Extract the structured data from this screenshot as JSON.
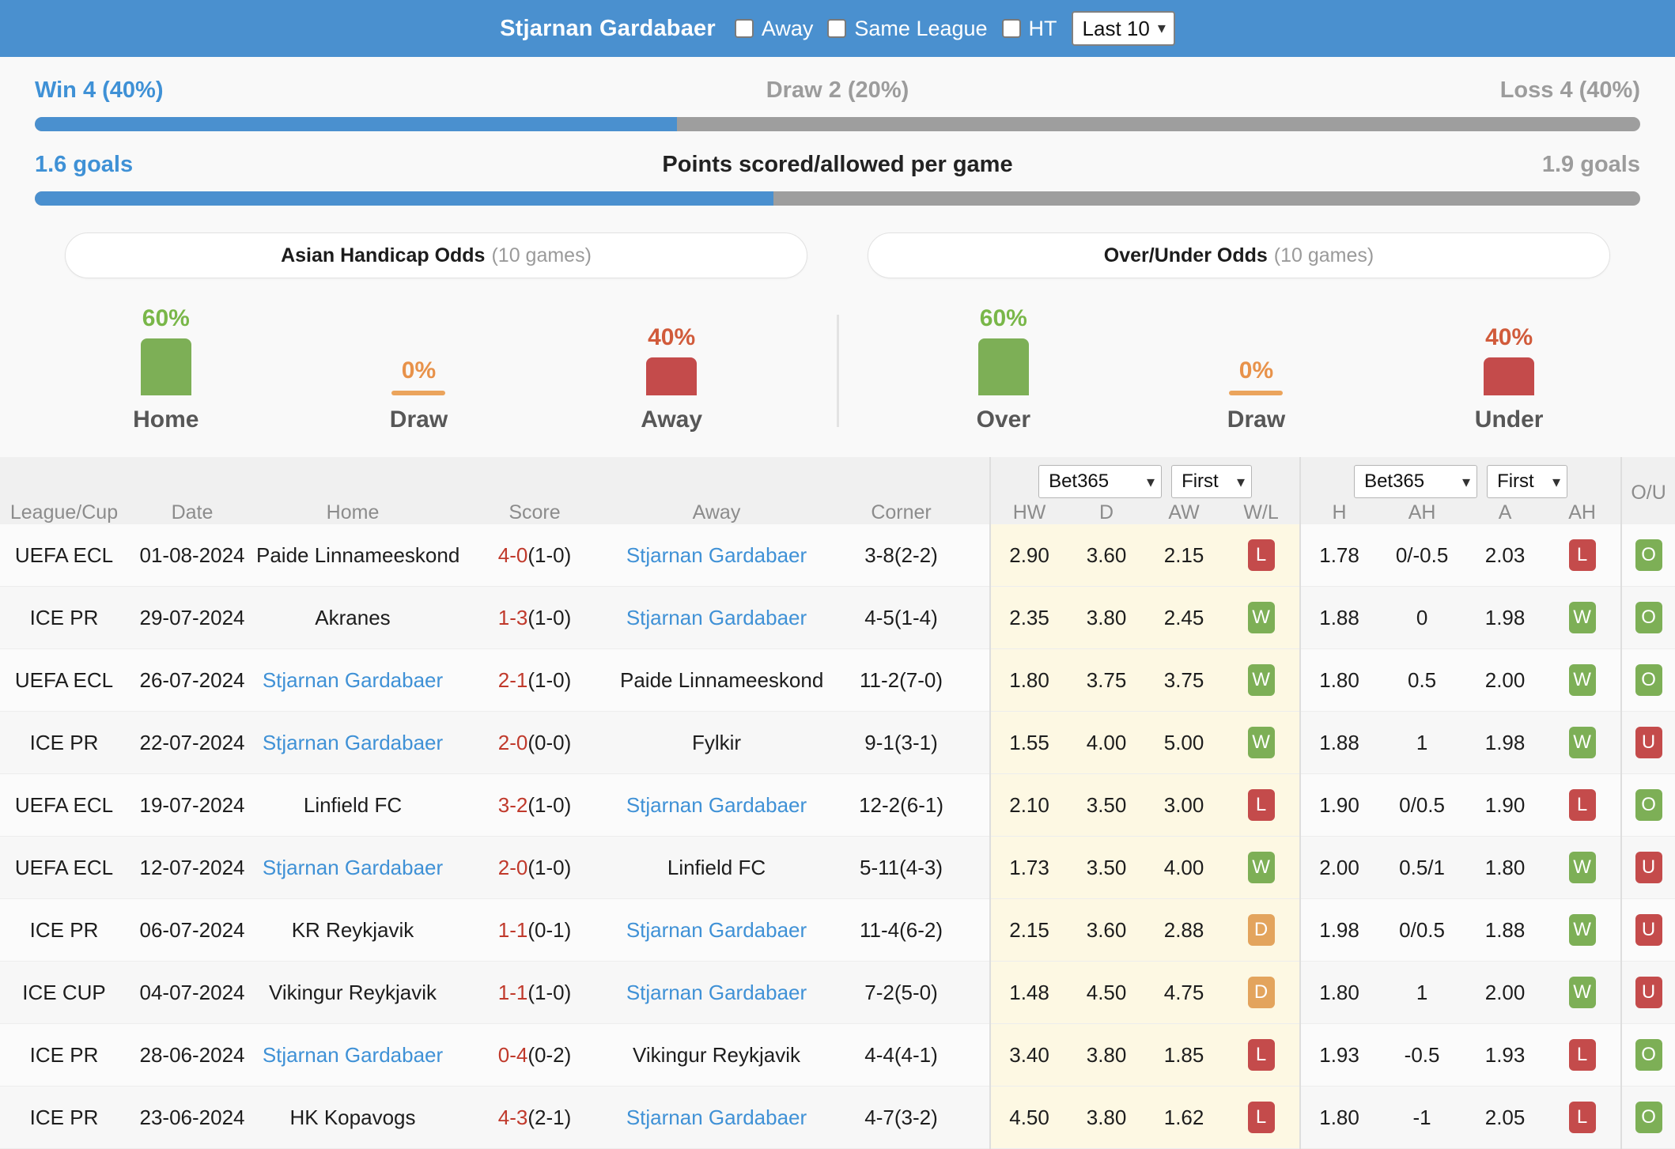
{
  "header": {
    "team": "Stjarnan Gardabaer",
    "filters": [
      {
        "label": "Away",
        "checked": false
      },
      {
        "label": "Same League",
        "checked": false
      },
      {
        "label": "HT",
        "checked": false
      }
    ],
    "range_select": {
      "value": "Last 10",
      "caret": "chevron-down-icon"
    }
  },
  "summary": {
    "wdl": {
      "left": "Win 4 (40%)",
      "center": "Draw 2 (20%)",
      "right": "Loss 4 (40%)",
      "fill_pct": 40
    },
    "goals": {
      "left": "1.6 goals",
      "center": "Points scored/allowed per game",
      "right": "1.9 goals",
      "fill_pct": 46
    }
  },
  "tabs": [
    {
      "label": "Asian Handicap Odds",
      "sub": "(10 games)",
      "active": true
    },
    {
      "label": "Over/Under Odds",
      "sub": "(10 games)",
      "active": false
    }
  ],
  "chart_data": [
    {
      "type": "bar",
      "title": "Asian Handicap Odds (10 games)",
      "categories": [
        "Home",
        "Draw",
        "Away"
      ],
      "values": [
        60,
        0,
        40
      ],
      "labels": [
        "60%",
        "0%",
        "40%"
      ],
      "colors": [
        "#7daf56",
        "#eba45c",
        "#c44b4b"
      ],
      "ylabel": "",
      "xlabel": "",
      "ylim": [
        0,
        100
      ],
      "grid": false,
      "legend": "none"
    },
    {
      "type": "bar",
      "title": "Over/Under Odds (10 games)",
      "categories": [
        "Over",
        "Draw",
        "Under"
      ],
      "values": [
        60,
        0,
        40
      ],
      "labels": [
        "60%",
        "0%",
        "40%"
      ],
      "colors": [
        "#7daf56",
        "#eba45c",
        "#c44b4b"
      ],
      "ylabel": "",
      "xlabel": "",
      "ylim": [
        0,
        100
      ],
      "grid": false,
      "legend": "none"
    }
  ],
  "table": {
    "headers": {
      "league": "League/Cup",
      "date": "Date",
      "home": "Home",
      "score": "Score",
      "away": "Away",
      "corner": "Corner",
      "hw": "HW",
      "d": "D",
      "aw": "AW",
      "wl": "W/L",
      "h": "H",
      "ah1": "AH",
      "a": "A",
      "ah2": "AH",
      "ou": "O/U"
    },
    "selectors": {
      "book1": "Bet365",
      "time1": "First",
      "book2": "Bet365",
      "time2": "First"
    },
    "rows": [
      {
        "league": "UEFA ECL",
        "date": "01-08-2024",
        "home": "Paide Linnameeskond",
        "home_hl": false,
        "score": "4-0",
        "score_sub": "(1-0)",
        "away": "Stjarnan Gardabaer",
        "away_hl": true,
        "corner": "3-8(2-2)",
        "hw": "2.90",
        "d": "3.60",
        "aw": "2.15",
        "wl": "L",
        "h": "1.78",
        "ah1": "0/-0.5",
        "a": "2.03",
        "ah2": "L",
        "ou": "O"
      },
      {
        "league": "ICE PR",
        "date": "29-07-2024",
        "home": "Akranes",
        "home_hl": false,
        "score": "1-3",
        "score_sub": "(1-0)",
        "away": "Stjarnan Gardabaer",
        "away_hl": true,
        "corner": "4-5(1-4)",
        "hw": "2.35",
        "d": "3.80",
        "aw": "2.45",
        "wl": "W",
        "h": "1.88",
        "ah1": "0",
        "a": "1.98",
        "ah2": "W",
        "ou": "O"
      },
      {
        "league": "UEFA ECL",
        "date": "26-07-2024",
        "home": "Stjarnan Gardabaer",
        "home_hl": true,
        "score": "2-1",
        "score_sub": "(1-0)",
        "away": "Paide Linnameeskond",
        "away_hl": false,
        "corner": "11-2(7-0)",
        "hw": "1.80",
        "d": "3.75",
        "aw": "3.75",
        "wl": "W",
        "h": "1.80",
        "ah1": "0.5",
        "a": "2.00",
        "ah2": "W",
        "ou": "O"
      },
      {
        "league": "ICE PR",
        "date": "22-07-2024",
        "home": "Stjarnan Gardabaer",
        "home_hl": true,
        "score": "2-0",
        "score_sub": "(0-0)",
        "away": "Fylkir",
        "away_hl": false,
        "corner": "9-1(3-1)",
        "hw": "1.55",
        "d": "4.00",
        "aw": "5.00",
        "wl": "W",
        "h": "1.88",
        "ah1": "1",
        "a": "1.98",
        "ah2": "W",
        "ou": "U"
      },
      {
        "league": "UEFA ECL",
        "date": "19-07-2024",
        "home": "Linfield FC",
        "home_hl": false,
        "score": "3-2",
        "score_sub": "(1-0)",
        "away": "Stjarnan Gardabaer",
        "away_hl": true,
        "corner": "12-2(6-1)",
        "hw": "2.10",
        "d": "3.50",
        "aw": "3.00",
        "wl": "L",
        "h": "1.90",
        "ah1": "0/0.5",
        "a": "1.90",
        "ah2": "L",
        "ou": "O"
      },
      {
        "league": "UEFA ECL",
        "date": "12-07-2024",
        "home": "Stjarnan Gardabaer",
        "home_hl": true,
        "score": "2-0",
        "score_sub": "(1-0)",
        "away": "Linfield FC",
        "away_hl": false,
        "corner": "5-11(4-3)",
        "hw": "1.73",
        "d": "3.50",
        "aw": "4.00",
        "wl": "W",
        "h": "2.00",
        "ah1": "0.5/1",
        "a": "1.80",
        "ah2": "W",
        "ou": "U"
      },
      {
        "league": "ICE PR",
        "date": "06-07-2024",
        "home": "KR Reykjavik",
        "home_hl": false,
        "score": "1-1",
        "score_sub": "(0-1)",
        "away": "Stjarnan Gardabaer",
        "away_hl": true,
        "corner": "11-4(6-2)",
        "hw": "2.15",
        "d": "3.60",
        "aw": "2.88",
        "wl": "D",
        "h": "1.98",
        "ah1": "0/0.5",
        "a": "1.88",
        "ah2": "W",
        "ou": "U"
      },
      {
        "league": "ICE CUP",
        "date": "04-07-2024",
        "home": "Vikingur Reykjavik",
        "home_hl": false,
        "score": "1-1",
        "score_sub": "(1-0)",
        "away": "Stjarnan Gardabaer",
        "away_hl": true,
        "corner": "7-2(5-0)",
        "hw": "1.48",
        "d": "4.50",
        "aw": "4.75",
        "wl": "D",
        "h": "1.80",
        "ah1": "1",
        "a": "2.00",
        "ah2": "W",
        "ou": "U"
      },
      {
        "league": "ICE PR",
        "date": "28-06-2024",
        "home": "Stjarnan Gardabaer",
        "home_hl": true,
        "score": "0-4",
        "score_sub": "(0-2)",
        "away": "Vikingur Reykjavik",
        "away_hl": false,
        "corner": "4-4(4-1)",
        "hw": "3.40",
        "d": "3.80",
        "aw": "1.85",
        "wl": "L",
        "h": "1.93",
        "ah1": "-0.5",
        "a": "1.93",
        "ah2": "L",
        "ou": "O"
      },
      {
        "league": "ICE PR",
        "date": "23-06-2024",
        "home": "HK Kopavogs",
        "home_hl": false,
        "score": "4-3",
        "score_sub": "(2-1)",
        "away": "Stjarnan Gardabaer",
        "away_hl": true,
        "corner": "4-7(3-2)",
        "hw": "4.50",
        "d": "3.80",
        "aw": "1.62",
        "wl": "L",
        "h": "1.80",
        "ah1": "-1",
        "a": "2.05",
        "ah2": "L",
        "ou": "O"
      }
    ]
  },
  "colors": {
    "accent_blue": "#4a90cf",
    "green": "#7daf56",
    "red": "#c44b4b",
    "orange": "#e3a45d",
    "highlight": "#fdf8e3",
    "score_red": "#c0392b"
  }
}
